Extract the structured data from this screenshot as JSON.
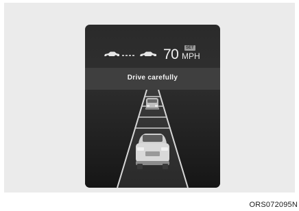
{
  "cluster": {
    "set_speed": "70",
    "speed_unit": "MPH",
    "set_badge": "SET",
    "message": "Drive carefully"
  },
  "figure_code": "ORS072095N",
  "icons": [
    "lead-vehicle-icon",
    "distance-gap-icon",
    "own-vehicle-icon"
  ]
}
